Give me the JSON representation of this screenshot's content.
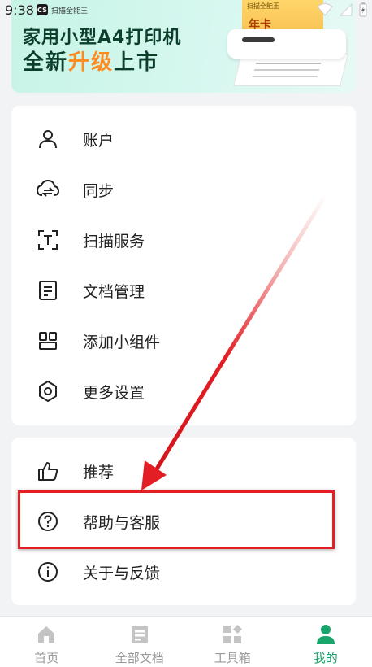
{
  "status_bar": {
    "time": "9:38",
    "app_icon_text": "CS",
    "app_name": "扫描全能王"
  },
  "banner": {
    "line1": "家用小型A4打印机",
    "line2_prefix": "全新",
    "line2_highlight": "升级",
    "line2_suffix": "上市",
    "card_mini": "扫描全能王",
    "card_text": "年卡"
  },
  "menu_group_1": [
    {
      "label": "账户",
      "icon": "user-icon"
    },
    {
      "label": "同步",
      "icon": "cloud-sync-icon"
    },
    {
      "label": "扫描服务",
      "icon": "scan-text-icon"
    },
    {
      "label": "文档管理",
      "icon": "document-icon"
    },
    {
      "label": "添加小组件",
      "icon": "widget-icon"
    },
    {
      "label": "更多设置",
      "icon": "gear-icon"
    }
  ],
  "menu_group_2": [
    {
      "label": "推荐",
      "icon": "thumbs-up-icon"
    },
    {
      "label": "帮助与客服",
      "icon": "help-circle-icon"
    },
    {
      "label": "关于与反馈",
      "icon": "info-circle-icon"
    }
  ],
  "bottom_nav": [
    {
      "label": "首页",
      "icon": "home-icon",
      "active": false
    },
    {
      "label": "全部文档",
      "icon": "documents-icon",
      "active": false
    },
    {
      "label": "工具箱",
      "icon": "toolbox-icon",
      "active": false
    },
    {
      "label": "我的",
      "icon": "profile-icon",
      "active": true
    }
  ],
  "colors": {
    "accent": "#19a56b",
    "annotation_red": "#e31e24",
    "banner_highlight": "#ff8a1f",
    "inactive_nav": "#c4c4c4"
  }
}
